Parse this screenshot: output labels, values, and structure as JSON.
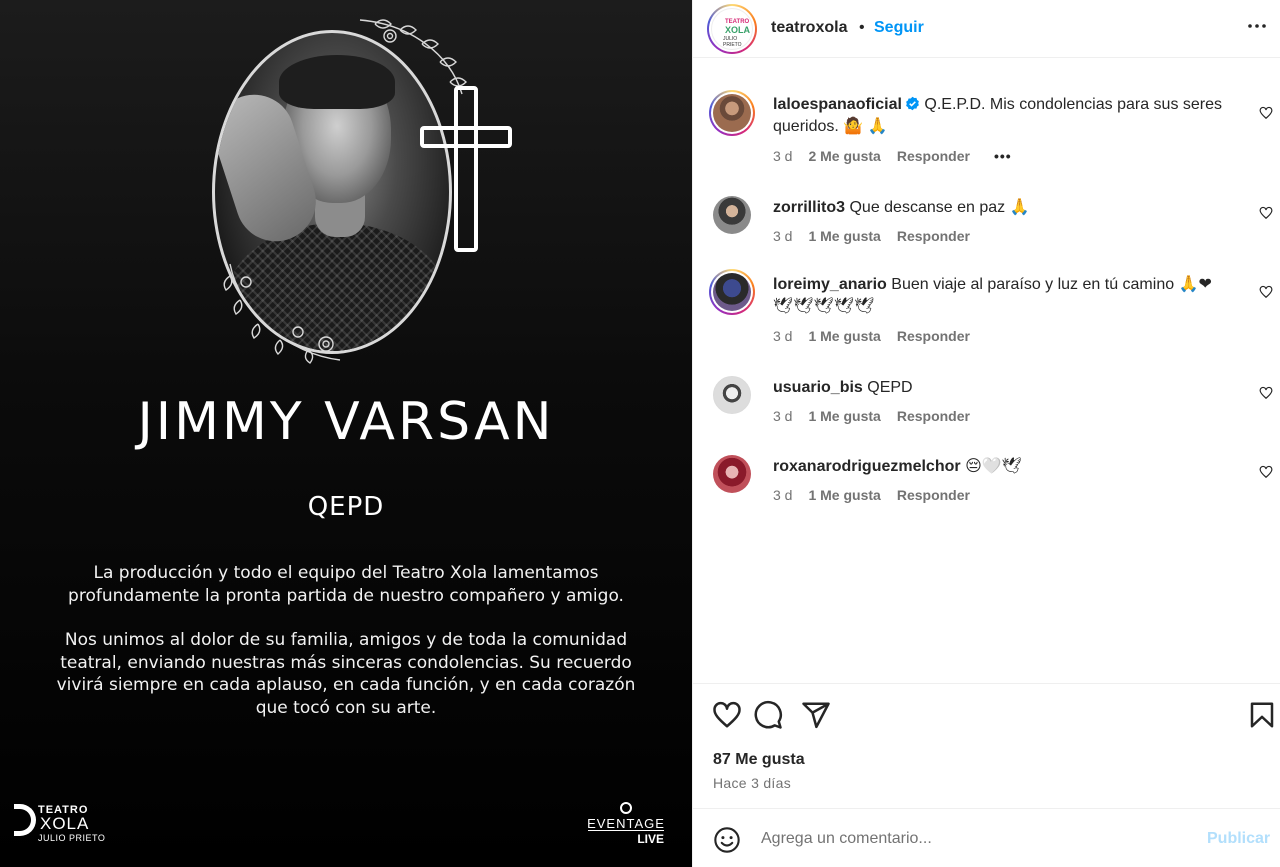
{
  "post": {
    "title": "JIMMY VARSAN",
    "subtitle": "QEPD",
    "paragraph1": "La producción y todo el equipo del Teatro Xola lamentamos profundamente la pronta partida de nuestro compañero y amigo.",
    "paragraph2": "Nos unimos al dolor de su familia, amigos y de toda la comunidad teatral, enviando nuestras más sinceras condolencias. Su recuerdo vivirá siempre en cada aplauso, en cada función, y en cada corazón que tocó con su arte.",
    "logo_left": {
      "line1": "TEATRO",
      "line2": "XOLA",
      "line3": "JULIO PRIETO"
    },
    "logo_right": {
      "line1": "EVENTAGE",
      "line2": "LIVE"
    }
  },
  "header": {
    "username": "teatroxola",
    "separator": "•",
    "follow_label": "Seguir",
    "avatar_logo": {
      "line1": "TEATRO",
      "line2": "XOLA",
      "line3": "JULIO PRIETO"
    }
  },
  "comments": [
    {
      "user": "laloespanaoficial",
      "text": "Q.E.P.D. Mis condolencias para sus seres queridos. 🤷 🙏",
      "time": "3 d",
      "likes": "2 Me gusta",
      "reply": "Responder",
      "more": "•••"
    },
    {
      "user": "zorrillito3",
      "text": "Que descanse en paz 🙏",
      "time": "3 d",
      "likes": "1 Me gusta",
      "reply": "Responder"
    },
    {
      "user": "loreimy_anario",
      "text": "Buen viaje al paraíso y luz en tú camino 🙏❤",
      "text2": "🕊🕊🕊🕊🕊",
      "time": "3 d",
      "likes": "1 Me gusta",
      "reply": "Responder"
    },
    {
      "user": "usuario_bis",
      "text": "QEPD",
      "time": "3 d",
      "likes": "1 Me gusta",
      "reply": "Responder"
    },
    {
      "user": "roxanarodriguezmelchor",
      "text": "😔🤍🕊",
      "time": "3 d",
      "likes": "1 Me gusta",
      "reply": "Responder"
    }
  ],
  "footer": {
    "likes_count": "87 Me gusta",
    "post_time": "Hace 3 días",
    "comment_placeholder": "Agrega un comentario...",
    "publish_label": "Publicar"
  },
  "icons": {
    "like": "heart-icon",
    "comment": "comment-icon",
    "share": "send-icon",
    "save": "bookmark-icon",
    "emoji": "emoji-icon",
    "more": "more-icon",
    "verified": "verified-badge-icon"
  },
  "colors": {
    "link": "#0095f6",
    "muted": "#737373",
    "publish_disabled": "#b2dffc",
    "verified": "#0095f6"
  }
}
